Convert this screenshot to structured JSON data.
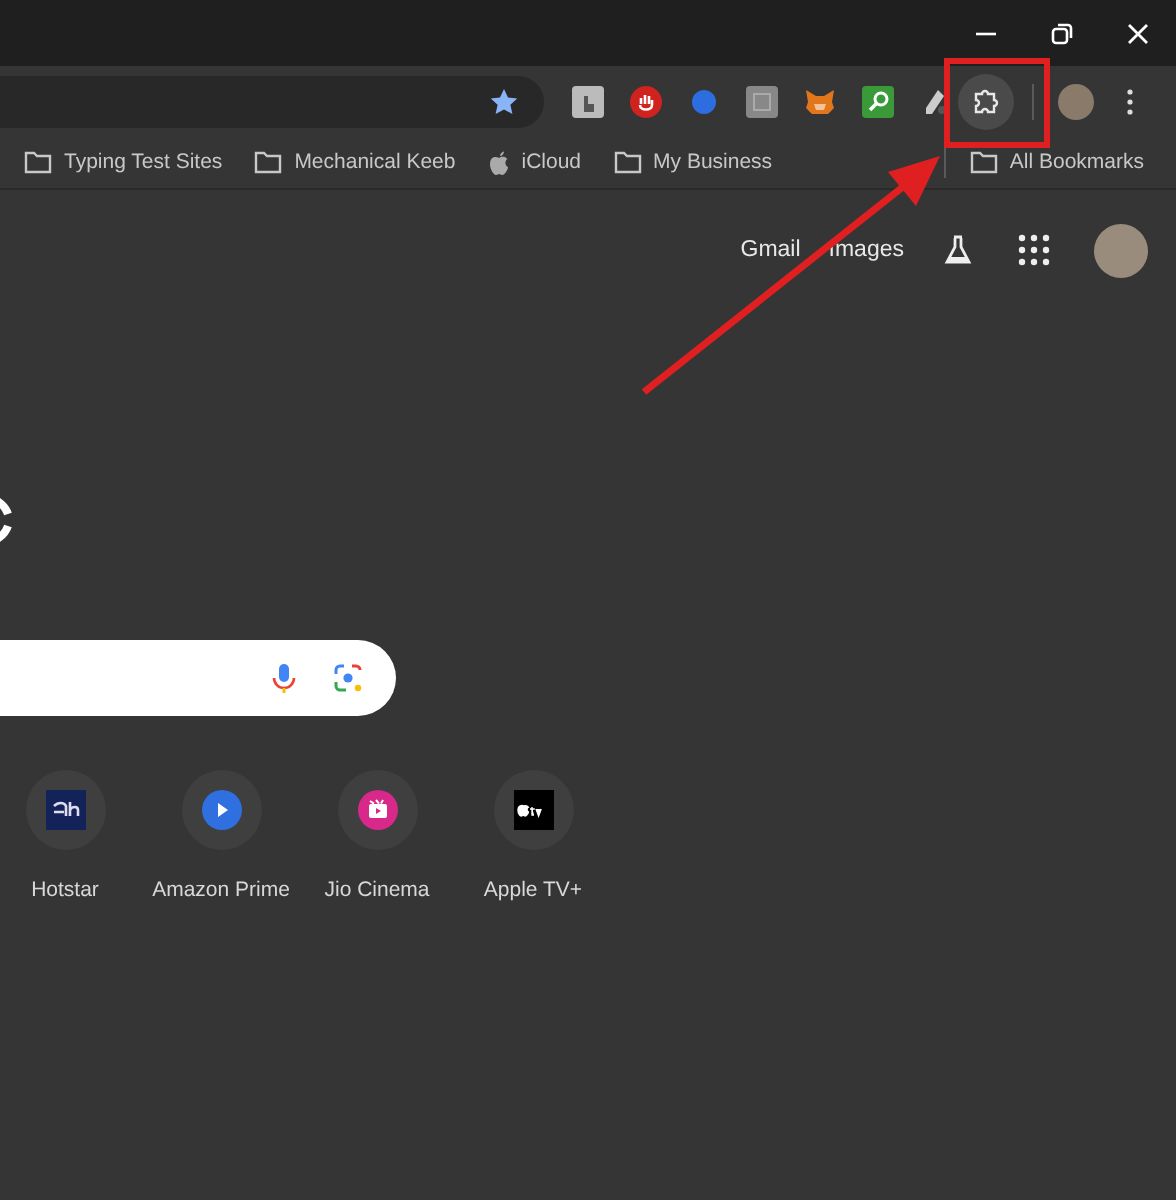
{
  "bookmarks": [
    {
      "label": "Typing Test Sites",
      "kind": "folder"
    },
    {
      "label": "Mechanical Keeb",
      "kind": "folder"
    },
    {
      "label": "iCloud",
      "kind": "apple"
    },
    {
      "label": "My Business",
      "kind": "folder"
    }
  ],
  "all_bookmarks": {
    "label": "All Bookmarks"
  },
  "header_links": [
    "Gmail",
    "Images"
  ],
  "shortcuts": [
    {
      "label": "Hotstar",
      "kind": "hotstar"
    },
    {
      "label": "Amazon Prime",
      "kind": "prime"
    },
    {
      "label": "Jio Cinema",
      "kind": "jio"
    },
    {
      "label": "Apple TV+",
      "kind": "appletv"
    }
  ]
}
